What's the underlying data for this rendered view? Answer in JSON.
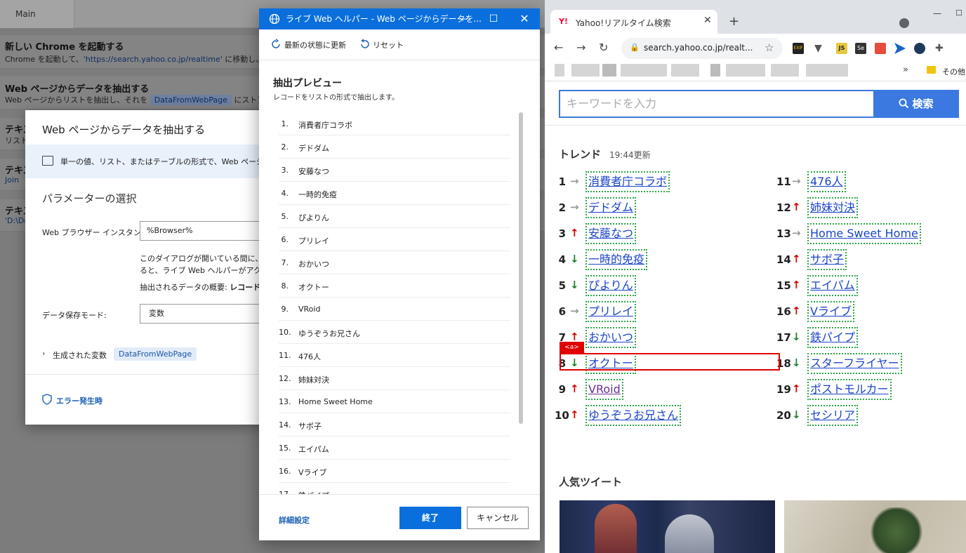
{
  "pad": {
    "tab_main": "Main",
    "actions": [
      {
        "title": "新しい Chrome を起動する",
        "desc_prefix": "Chrome を起動して、",
        "desc_value": "'https://search.yahoo.co.jp/realtime'",
        "desc_suffix": " に移動し、イン"
      },
      {
        "title": "Web ページからデータを抽出する",
        "desc_prefix": "Web ページからリストを抽出し、それを ",
        "desc_chip": "DataFromWebPage",
        "desc_suffix": " にストアします"
      },
      {
        "title": "テキス",
        "desc": "リスト"
      },
      {
        "title": "テキス",
        "desc": "Join"
      },
      {
        "title": "テキス",
        "desc": "'D:\\Dr"
      }
    ]
  },
  "settings": {
    "title": "Web ページからデータを抽出する",
    "info": "単一の値、リスト、またはテーブルの形式で、Web ページの特定",
    "param_heading": "パラメーターの選択",
    "browser_label": "Web ブラウザー インスタンス:",
    "browser_value": "%Browser%",
    "note_line1": "このダイアログが開いている間に、実際",
    "note_line2": "ると、ライブ Web ヘルパーがアクティブ",
    "summary_prefix": "抽出されるデータの概要: ",
    "summary_bold": "レコードを リ",
    "mode_label": "データ保存モード:",
    "mode_value": "変数",
    "generated_vars": "生成された変数",
    "generated_chip": "DataFromWebPage",
    "on_error": "エラー発生時"
  },
  "helper": {
    "title": "ライブ Web ヘルパー - Web ページからデータを...",
    "refresh": "最新の状態に更新",
    "reset": "リセット",
    "preview_title": "抽出プレビュー",
    "preview_sub": "レコードをリストの形式で抽出します。",
    "items": [
      "消費者庁コラボ",
      "デドダム",
      "安藤なつ",
      "一時的免疫",
      "ぴよりん",
      "プリレイ",
      "おかいつ",
      "オクトー",
      "VRoid",
      "ゆうぞうお兄さん",
      "476人",
      "姉妹対決",
      "Home Sweet Home",
      "サボ子",
      "エイパム",
      "Vライブ",
      "鉄パイプ"
    ],
    "advanced": "詳細設定",
    "finish": "終了",
    "cancel": "キャンセル"
  },
  "chrome": {
    "tab_title": "Yahoo!リアルタイム検索",
    "tab_favicon": "Y!",
    "url": "search.yahoo.co.jp/realt...",
    "bookmark_other": "その他の",
    "ext_exif": "EXIF",
    "ext_js": "JS",
    "ext_se": "Se"
  },
  "yahoo": {
    "search_placeholder": "キーワードを入力",
    "search_button": "検索",
    "trend_title": "トレンド",
    "trend_time": "19:44更新",
    "selected_tag": "<a>",
    "popular_title": "人気ツイート",
    "trends_left": [
      {
        "rank": "1",
        "dir": "flat",
        "word": "消費者庁コラボ",
        "visited": false
      },
      {
        "rank": "2",
        "dir": "flat",
        "word": "デドダム",
        "visited": false
      },
      {
        "rank": "3",
        "dir": "up",
        "word": "安藤なつ",
        "visited": false
      },
      {
        "rank": "4",
        "dir": "down",
        "word": "一時的免疫",
        "visited": false
      },
      {
        "rank": "5",
        "dir": "down",
        "word": "ぴよりん",
        "visited": false
      },
      {
        "rank": "6",
        "dir": "flat",
        "word": "プリレイ",
        "visited": false
      },
      {
        "rank": "7",
        "dir": "up",
        "word": "おかいつ",
        "visited": false
      },
      {
        "rank": "8",
        "dir": "down",
        "word": "オクトー",
        "visited": false
      },
      {
        "rank": "9",
        "dir": "up",
        "word": "VRoid",
        "visited": true
      },
      {
        "rank": "10",
        "dir": "up",
        "word": "ゆうぞうお兄さん",
        "visited": false
      }
    ],
    "trends_right": [
      {
        "rank": "11",
        "dir": "flat",
        "word": "476人",
        "visited": false
      },
      {
        "rank": "12",
        "dir": "up",
        "word": "姉妹対決",
        "visited": false
      },
      {
        "rank": "13",
        "dir": "flat",
        "word": "Home Sweet Home",
        "visited": false
      },
      {
        "rank": "14",
        "dir": "up",
        "word": "サボ子",
        "visited": false
      },
      {
        "rank": "15",
        "dir": "up",
        "word": "エイパム",
        "visited": false
      },
      {
        "rank": "16",
        "dir": "up",
        "word": "Vライブ",
        "visited": false
      },
      {
        "rank": "17",
        "dir": "down",
        "word": "鉄パイプ",
        "visited": false
      },
      {
        "rank": "18",
        "dir": "down",
        "word": "スターフライヤー",
        "visited": false
      },
      {
        "rank": "19",
        "dir": "up",
        "word": "ポストモルカー",
        "visited": false
      },
      {
        "rank": "20",
        "dir": "down",
        "word": "セシリア",
        "visited": false
      }
    ]
  },
  "colors": {
    "accent_blue": "#0a6fdc",
    "yahoo_blue": "#3b79e0",
    "up_red": "#d50000",
    "down_green": "#1b7f2c",
    "selection_red": "#e00000"
  }
}
